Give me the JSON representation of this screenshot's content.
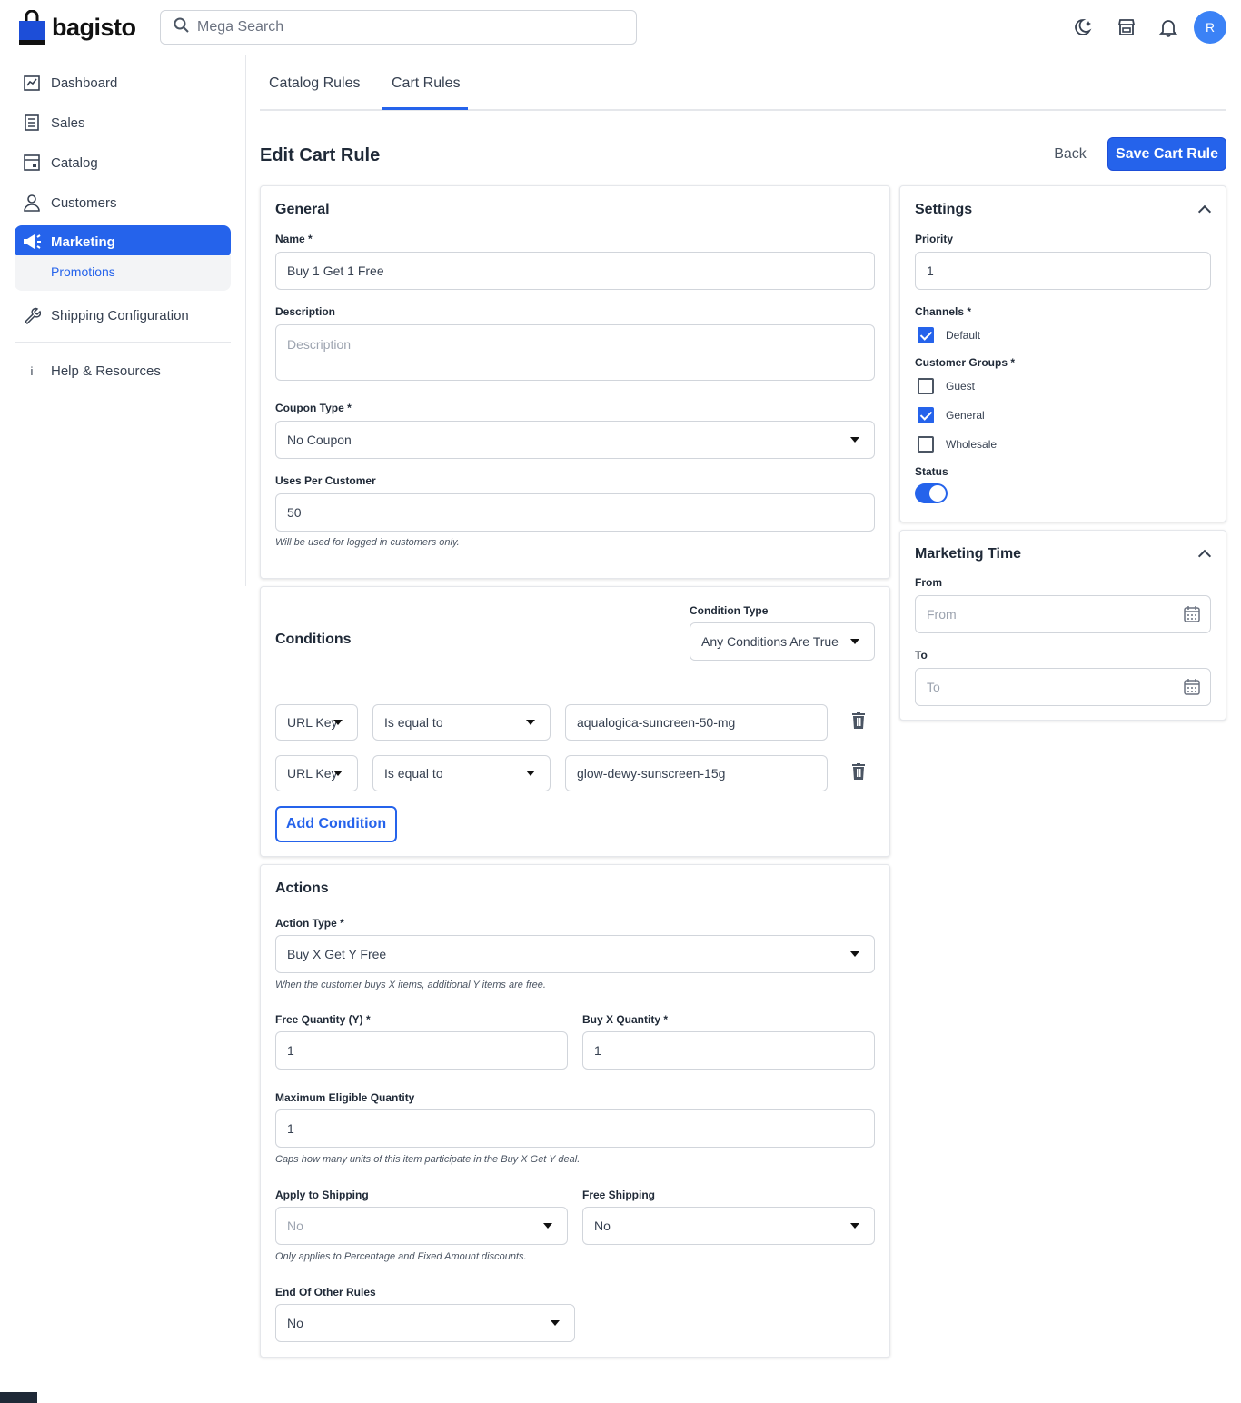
{
  "app": {
    "name": "bagisto"
  },
  "header": {
    "search_placeholder": "Mega Search",
    "avatar_letter": "R"
  },
  "sidebar": {
    "items": [
      {
        "label": "Dashboard",
        "icon": "dashboard-icon"
      },
      {
        "label": "Sales",
        "icon": "sales-icon"
      },
      {
        "label": "Catalog",
        "icon": "catalog-icon"
      },
      {
        "label": "Customers",
        "icon": "customers-icon"
      },
      {
        "label": "Marketing",
        "icon": "megaphone-icon",
        "active": true
      },
      {
        "label": "Shipping Configuration",
        "icon": "wrench-icon"
      },
      {
        "label": "Help & Resources",
        "icon": "info-icon"
      }
    ],
    "submenu": {
      "label": "Promotions"
    }
  },
  "tabs": [
    {
      "label": "Catalog Rules"
    },
    {
      "label": "Cart Rules",
      "active": true
    }
  ],
  "page": {
    "title": "Edit Cart Rule",
    "back_label": "Back",
    "save_label": "Save Cart Rule"
  },
  "general": {
    "title": "General",
    "name_label": "Name *",
    "name_value": "Buy 1 Get 1 Free",
    "description_label": "Description",
    "description_placeholder": "Description",
    "coupon_type_label": "Coupon Type *",
    "coupon_type_value": "No Coupon",
    "uses_label": "Uses Per Customer",
    "uses_value": "50",
    "uses_hint": "Will be used for logged in customers only."
  },
  "conditions": {
    "title": "Conditions",
    "condition_type_label": "Condition Type",
    "condition_type_value": "Any Conditions Are True",
    "rows": [
      {
        "attribute": "URL Key",
        "operator": "Is equal to",
        "value": "aqualogica-suncreen-50-mg"
      },
      {
        "attribute": "URL Key",
        "operator": "Is equal to",
        "value": "glow-dewy-sunscreen-15g"
      }
    ],
    "add_label": "Add Condition"
  },
  "actions": {
    "title": "Actions",
    "action_type_label": "Action Type *",
    "action_type_value": "Buy X Get Y Free",
    "action_type_hint": "When the customer buys X items, additional Y items are free.",
    "free_qty_label": "Free Quantity (Y) *",
    "free_qty_value": "1",
    "buy_qty_label": "Buy X Quantity *",
    "buy_qty_value": "1",
    "max_qty_label": "Maximum Eligible Quantity",
    "max_qty_value": "1",
    "max_qty_hint": "Caps how many units of this item participate in the Buy X Get Y deal.",
    "apply_shipping_label": "Apply to Shipping",
    "apply_shipping_value": "No",
    "apply_shipping_hint": "Only applies to Percentage and Fixed Amount discounts.",
    "free_shipping_label": "Free Shipping",
    "free_shipping_value": "No",
    "end_rules_label": "End Of Other Rules",
    "end_rules_value": "No"
  },
  "settings": {
    "title": "Settings",
    "priority_label": "Priority",
    "priority_value": "1",
    "channels_label": "Channels *",
    "channels": [
      {
        "label": "Default",
        "checked": true
      }
    ],
    "groups_label": "Customer Groups *",
    "groups": [
      {
        "label": "Guest",
        "checked": false
      },
      {
        "label": "General",
        "checked": true
      },
      {
        "label": "Wholesale",
        "checked": false
      }
    ],
    "status_label": "Status",
    "status_on": true
  },
  "marketing_time": {
    "title": "Marketing Time",
    "from_label": "From",
    "from_placeholder": "From",
    "to_label": "To",
    "to_placeholder": "To"
  },
  "colors": {
    "accent": "#2563eb",
    "border": "#d1d5db"
  }
}
